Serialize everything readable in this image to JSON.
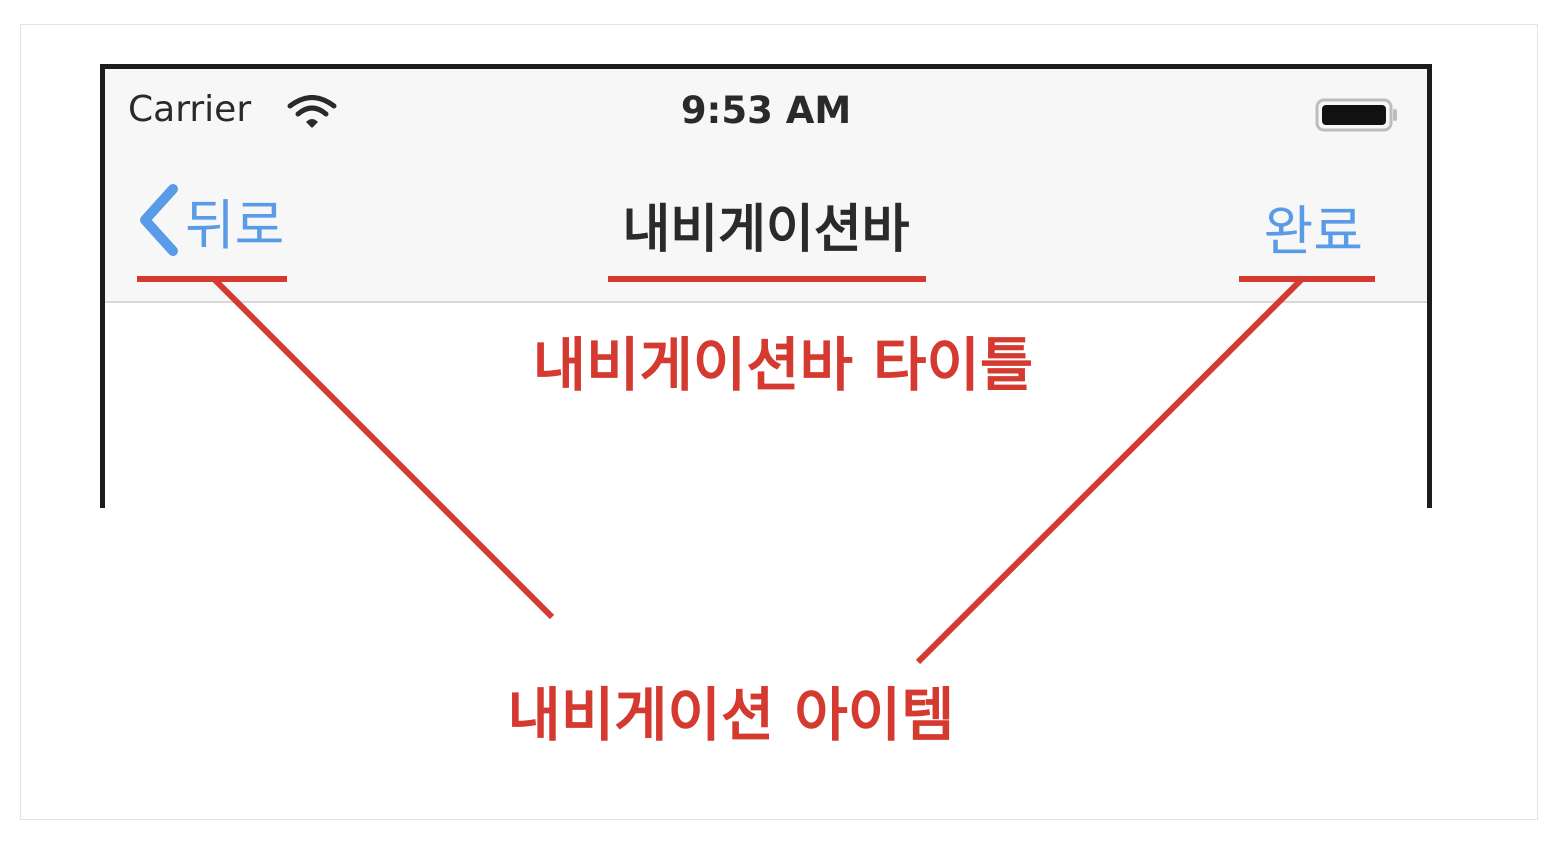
{
  "status_bar": {
    "carrier": "Carrier",
    "time": "9:53 AM",
    "wifi_icon": "wifi-icon",
    "battery_icon": "battery-icon"
  },
  "nav_bar": {
    "back_label": "뒤로",
    "back_icon": "chevron-left-icon",
    "title": "내비게이션바",
    "done_label": "완료",
    "tint_color": "#5a9be8"
  },
  "annotations": {
    "title_label": "내비게이션바 타이틀",
    "items_label": "내비게이션 아이템",
    "color": "#d43a2f"
  }
}
